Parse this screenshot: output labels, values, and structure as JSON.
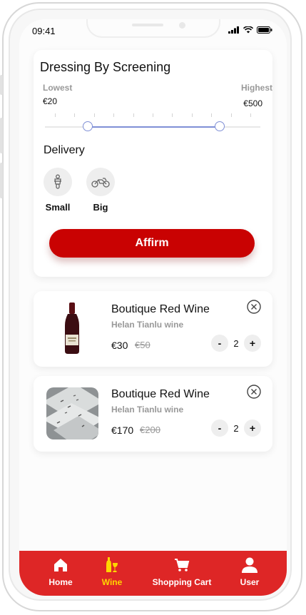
{
  "status_bar": {
    "time": "09:41"
  },
  "filter": {
    "title": "Dressing By Screening",
    "lowest_label": "Lowest",
    "lowest_value": "€20",
    "highest_label": "Highest",
    "highest_value": "€500",
    "range_min_fraction": 0.2,
    "range_max_fraction": 0.81,
    "delivery_title": "Delivery",
    "delivery_options": [
      {
        "label": "Small",
        "icon": "scooter-icon"
      },
      {
        "label": "Big",
        "icon": "motorcycle-icon"
      }
    ],
    "affirm_label": "Affirm"
  },
  "products": [
    {
      "name": "Boutique Red Wine",
      "subtitle": "Helan Tianlu wine",
      "price": "€30",
      "old_price": "€50",
      "quantity": "2",
      "minus": "-",
      "plus": "+"
    },
    {
      "name": "Boutique Red Wine",
      "subtitle": "Helan Tianlu wine",
      "price": "€170",
      "old_price": "€200",
      "quantity": "2",
      "minus": "-",
      "plus": "+"
    }
  ],
  "tabbar": {
    "active_color": "#ffd600",
    "background": "#de2626",
    "items": [
      {
        "label": "Home",
        "icon": "home-icon"
      },
      {
        "label": "Wine",
        "icon": "wine-icon",
        "active": true
      },
      {
        "label": "Shopping Cart",
        "icon": "cart-icon"
      },
      {
        "label": "User",
        "icon": "user-icon"
      }
    ]
  },
  "colors": {
    "accent": "#c90202",
    "slider": "#7f8fd6"
  }
}
